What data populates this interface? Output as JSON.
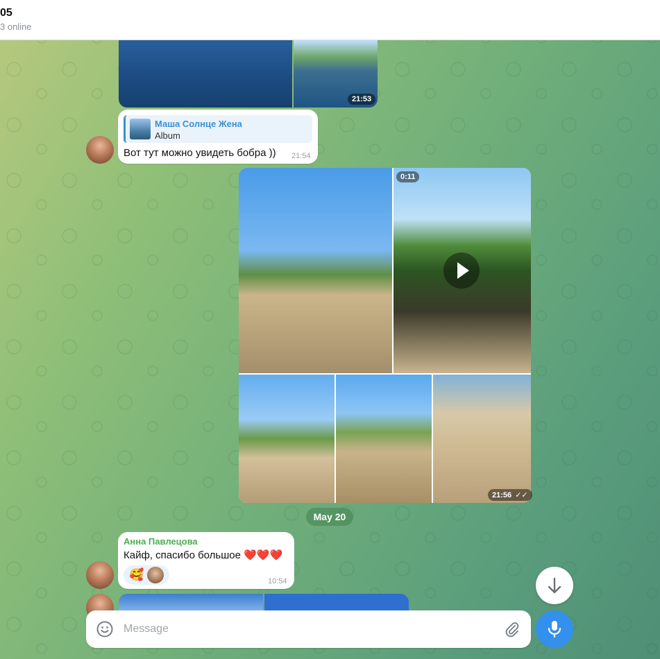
{
  "header": {
    "title": "05",
    "status": "3 online"
  },
  "album1": {
    "time": "21:53"
  },
  "reply_message": {
    "reply_name": "Маша Солнце Жена",
    "reply_text": "Album",
    "text": "Вот тут можно увидеть бобра ))",
    "time": "21:54"
  },
  "album2": {
    "video_duration": "0:11",
    "time": "21:56"
  },
  "date_separator": "May 20",
  "message2": {
    "sender": "Анна Павлецова",
    "text": "Кайф, спасибо большое ❤️❤️❤️",
    "reaction": "🥰",
    "time": "10:54"
  },
  "composer": {
    "placeholder": "Message"
  },
  "colors": {
    "accent": "#3390ec",
    "sender_name": "#4caf50",
    "reply_accent": "#3a8fd8"
  },
  "icons": [
    "emoji-icon",
    "attach-icon",
    "mic-icon",
    "arrow-down-icon",
    "play-icon",
    "double-check-icon"
  ]
}
